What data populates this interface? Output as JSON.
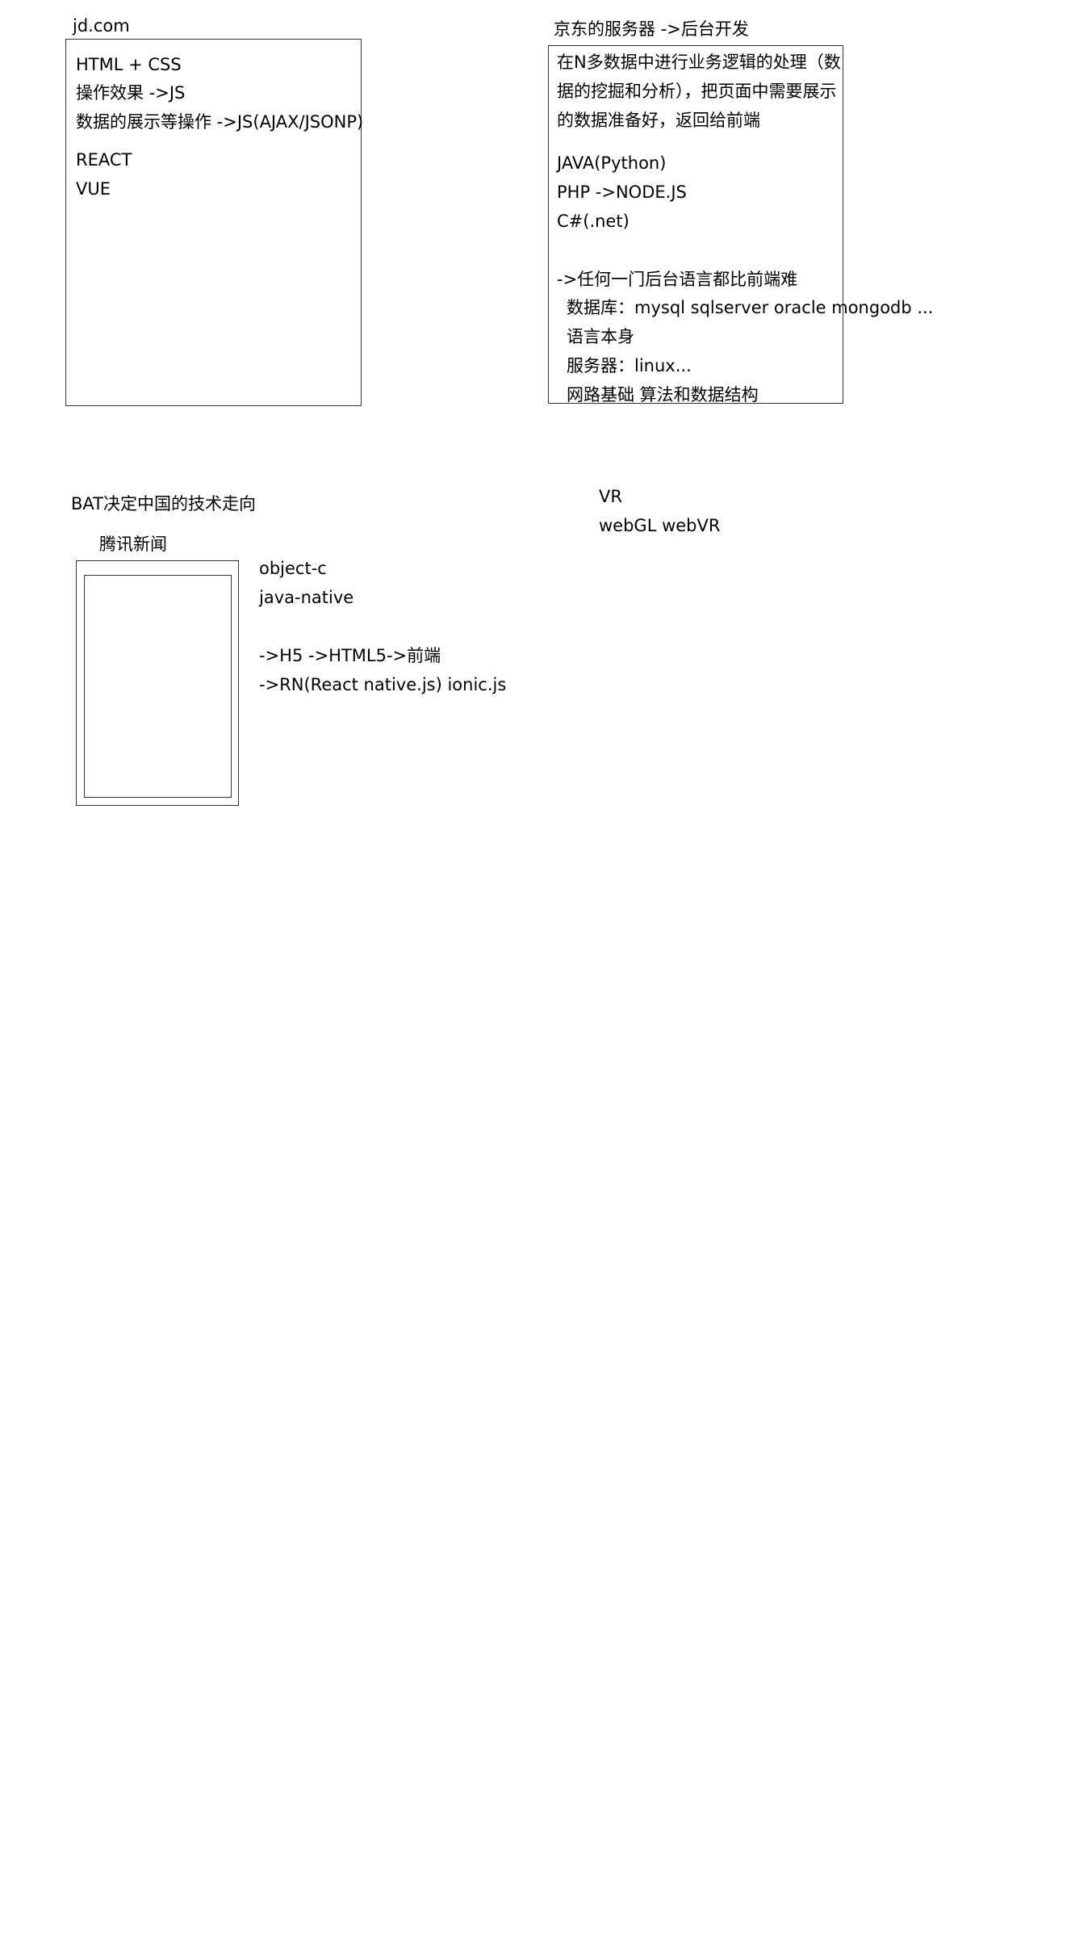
{
  "frontend": {
    "title": "jd.com",
    "lines": [
      "HTML + CSS",
      "操作效果 ->JS",
      "数据的展示等操作  ->JS(AJAX/JSONP)"
    ],
    "frameworks": [
      "REACT",
      "VUE"
    ]
  },
  "backend": {
    "title": "京东的服务器 ->后台开发",
    "description": [
      "在N多数据中进行业务逻辑的处理（数",
      "据的挖掘和分析），把页面中需要展示",
      "的数据准备好，返回给前端"
    ],
    "languages": [
      "JAVA(Python)",
      "PHP ->NODE.JS",
      "C#(.net)"
    ],
    "difficulty": "->任何一门后台语言都比前端难",
    "details": [
      "数据库：mysql sqlserver oracle mongodb ...",
      "语言本身",
      "服务器：linux...",
      "网路基础      算法和数据结构"
    ]
  },
  "bat": {
    "title": "BAT决定中国的技术走向",
    "app_label": "腾讯新闻",
    "native": [
      "object-c",
      "java-native"
    ],
    "hybrid": [
      "->H5 ->HTML5->前端",
      "->RN(React native.js)  ionic.js"
    ]
  },
  "vr": {
    "lines": [
      "VR",
      "webGL  webVR"
    ]
  }
}
